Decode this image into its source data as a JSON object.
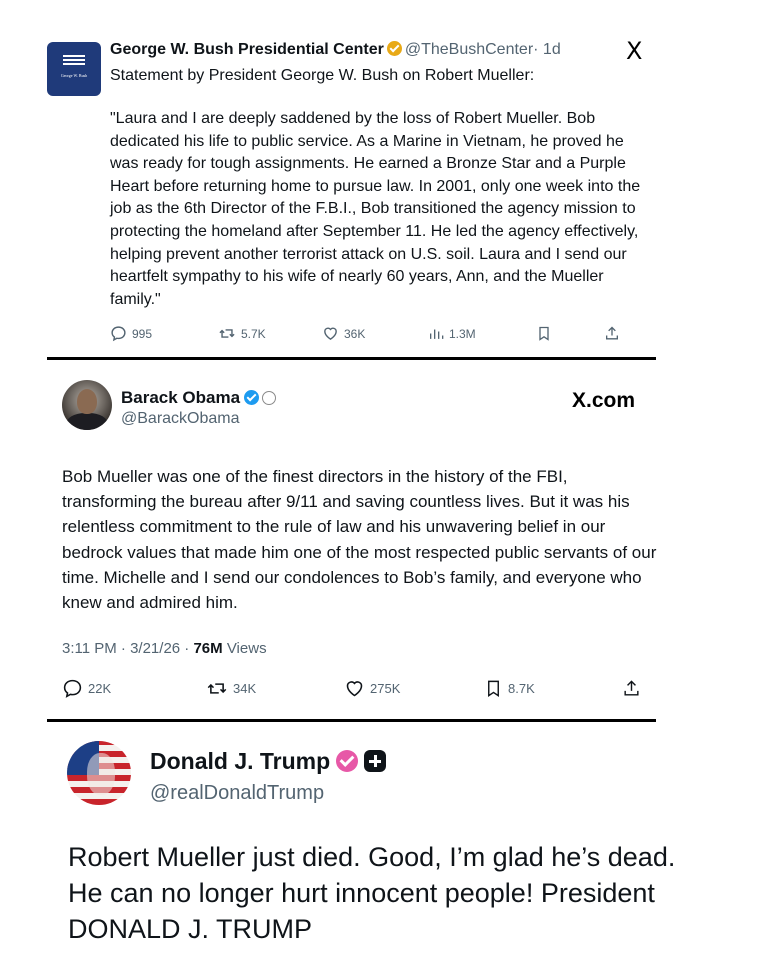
{
  "bush_post": {
    "org_name": "George W. Bush Presidential Center",
    "handle": "@TheBushCenter",
    "time": "· 1d",
    "platform_icon": "X",
    "avatar_text": "George W. Bush",
    "statement_title": "Statement by President George W. Bush on Robert Mueller:",
    "body": "\"Laura and I are deeply saddened by the loss of Robert Mueller. Bob dedicated his life to public service. As a Marine in Vietnam, he proved he was ready for tough assignments. He earned a Bronze Star and a Purple Heart before returning home to pursue law. In 2001, only one week into the job as the 6th Director of the F.B.I., Bob transitioned the agency mission to protecting the homeland after September 11. He led the agency effectively, helping prevent another terrorist attack on U.S. soil. Laura and I send our heartfelt sympathy to his wife of nearly 60 years, Ann, and the Mueller family.\"",
    "replies": "995",
    "reposts": "5.7K",
    "likes": "36K",
    "views": "1.3M",
    "badge_color": "#e8a917"
  },
  "obama_post": {
    "name": "Barack Obama",
    "handle": "@BarackObama",
    "source_label": "X.com",
    "body": "Bob Mueller was one of the finest directors in the history of the FBI, transforming the bureau after 9/11 and saving countless lives. But it was his relentless commitment to the rule of law and his unwavering belief in our bedrock values that made him one of the most respected public servants of our time. Michelle and I send our condolences to Bob’s family, and everyone who knew and admired him.",
    "timestamp": "3:11 PM · 3/21/26 · ",
    "view_count": "76M",
    "views_label": " Views",
    "replies": "22K",
    "reposts": "34K",
    "likes": "275K",
    "bookmarks": "8.7K",
    "badge_color": "#1d9bf0"
  },
  "trump_post": {
    "name": "Donald J. Trump",
    "handle": "@realDonaldTrump",
    "body": "Robert Mueller just died. Good, I’m glad he’s dead. He can no longer hurt innocent people! President DONALD J. TRUMP",
    "badge_color": "#e0218a"
  },
  "icons": [
    "reply-icon",
    "repost-icon",
    "like-icon",
    "views-icon",
    "bookmark-icon",
    "share-icon",
    "verified-badge-icon",
    "x-logo-icon"
  ]
}
